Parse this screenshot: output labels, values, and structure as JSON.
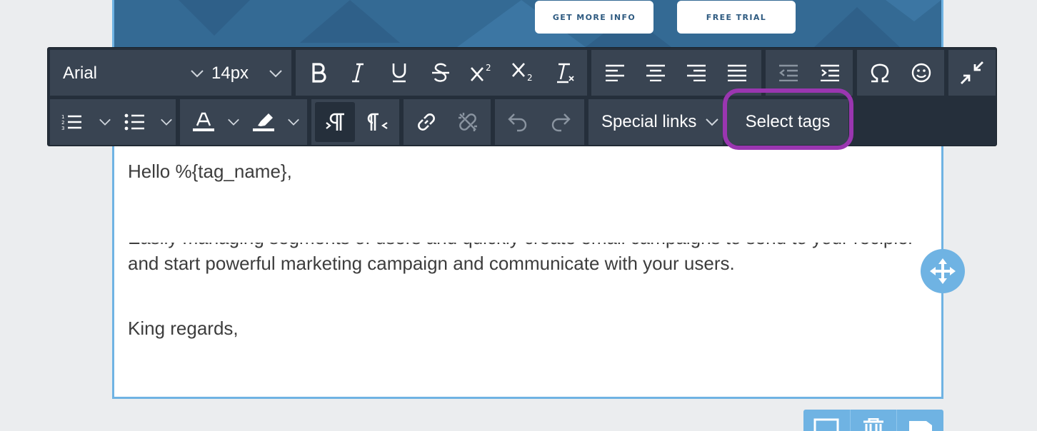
{
  "hero": {
    "buttons": [
      {
        "label": "GET MORE INFO"
      },
      {
        "label": "FREE TRIAL"
      }
    ]
  },
  "toolbar": {
    "font_family": "Arial",
    "font_size": "14px",
    "row1_icons": [
      "bold-icon",
      "italic-icon",
      "underline-icon",
      "strikethrough-icon",
      "superscript-icon",
      "subscript-icon",
      "clear-formatting-icon",
      "align-left-icon",
      "align-center-icon",
      "align-right-icon",
      "align-justify-icon",
      "outdent-icon",
      "indent-icon",
      "special-character-icon",
      "emoji-icon",
      "collapse-icon"
    ],
    "row2_icons": [
      "ordered-list-icon",
      "unordered-list-icon",
      "text-color-icon",
      "highlight-color-icon",
      "ltr-icon",
      "rtl-icon",
      "link-icon",
      "unlink-icon",
      "undo-icon",
      "redo-icon"
    ],
    "special_links_label": "Special links",
    "select_tags_label": "Select tags",
    "colors": {
      "toolbar_bg": "#252f3b",
      "group_bg": "#394452",
      "highlight": "#9a36b0",
      "accent": "#6fb3e3"
    }
  },
  "content": {
    "greeting": "Hello %{tag_name},",
    "clipped_line": "Easily managing segments of users and quickly create email campaigns to send to your recipients",
    "body_line": "and start powerful marketing campaign and communicate with your users.",
    "closing": "King regards,"
  }
}
